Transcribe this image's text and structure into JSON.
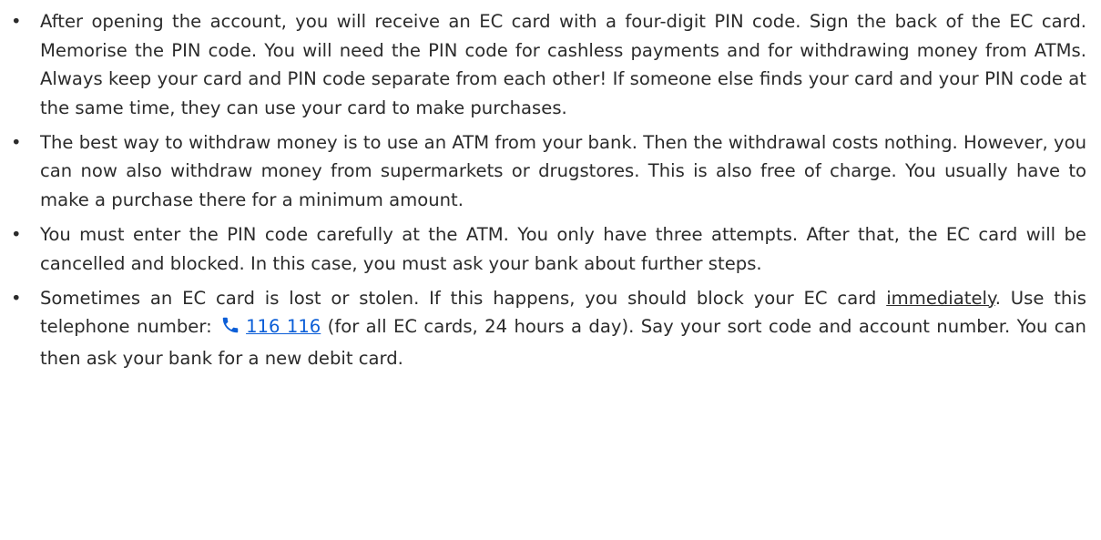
{
  "bullet_char": "•",
  "items": [
    {
      "text": "After opening the account, you will receive an EC card with a four-digit PIN code. Sign the back of the EC card. Memorise the PIN code. You will need the PIN code for cashless payments and for withdrawing money from ATMs. Always keep your card and PIN code separate from each other! If someone else finds your card and your PIN code at the same time, they can use your card to make purchases."
    },
    {
      "text": "The best way to withdraw money is to use an ATM from your bank. Then the withdrawal costs nothing. However, you can now also withdraw money from supermarkets or drugstores. This is also free of charge. You usually have to make a purchase there for a minimum amount."
    },
    {
      "text": "You must enter the PIN code carefully at the ATM. You only have three attempts. After that, the EC card will be cancelled and blocked. In this case, you must ask your bank about further steps."
    },
    {
      "part1": "Sometimes an EC card is lost or stolen. If this happens, you should block your EC card ",
      "emphasis": "immediately",
      "part2": ". Use this telephone number: ",
      "phone_icon": "phone-icon",
      "phone_number": "116 116",
      "part3": " (for all EC cards, 24 hours a day). Say your sort code and account number. You can then ask your bank for a new debit card."
    }
  ],
  "colors": {
    "text": "#2b2b2b",
    "link": "#0b5ed7",
    "icon": "#0b5ed7"
  }
}
